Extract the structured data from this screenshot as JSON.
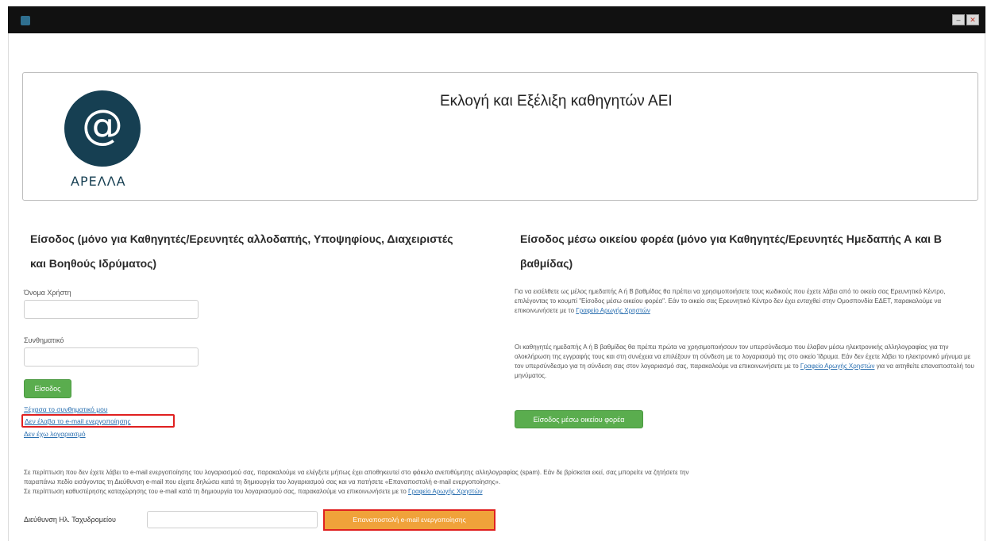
{
  "window": {
    "minimize_label": "–",
    "close_label": "✕"
  },
  "header": {
    "logo_text": "ΑΡΕΛΛΑ",
    "logo_glyph": "@",
    "title": "Εκλογή και Εξέλιξη καθηγητών ΑΕΙ"
  },
  "left": {
    "title": "Είσοδος (μόνο για Καθηγητές/Ερευνητές αλλοδαπής, Υποψηφίους, Διαχειριστές και Βοηθούς Ιδρύματος)",
    "username_label": "Όνομα Χρήστη",
    "password_label": "Συνθηματικό",
    "login_button": "Είσοδος",
    "forgot_password_link": "Ξέχασα το συνθηματικό μου",
    "no_email_link": "Δεν έλαβα το e-mail ενεργοποίησης",
    "register_link": "Δεν έχω λογαριασμό"
  },
  "right": {
    "title": "Είσοδος μέσω οικείου φορέα (μόνο για Καθηγητές/Ερευνητές Ημεδαπής Α και Β βαθμίδας)",
    "para1": "Για να εισέλθετε ως μέλος ημεδαπής Α ή Β βαθμίδας θα πρέπει να χρησιμοποιήσετε τους κωδικούς που έχετε λάβει από το οικείο σας Ερευνητικό Κέντρο, επιλέγοντας το κουμπί \"Είσοδος μέσω οικείου φορέα\". Εάν το οικείο σας Ερευνητικό Κέντρο δεν έχει ενταχθεί στην Ομοσπονδία ΕΔΕΤ, παρακαλούμε να επικοινωνήσετε με το",
    "para1_link": "Γραφείο Αρωγής Χρηστών",
    "para2": "Οι καθηγητές ημεδαπής Α ή Β βαθμίδας θα πρέπει πρώτα να χρησιμοποιήσουν τον υπερσύνδεσμο που έλαβαν μέσω ηλεκτρονικής αλληλογραφίας για την ολοκλήρωση της εγγραφής τους και στη συνέχεια να επιλέξουν τη σύνδεση με το λογαριασμό της στο οικείο Ίδρυμα. Εάν δεν έχετε λάβει το ηλεκτρονικό μήνυμα με τον υπερσύνδεσμο για τη σύνδεση σας στον λογαριασμό σας, παρακαλούμε να επικοινωνήσετε με το",
    "para2_link": "Γραφείο Αρωγής Χρηστών",
    "para2_end": "για να αιτηθείτε επαναποστολή του μηνύματος.",
    "login_button": "Είσοδος μέσω οικείου φορέα"
  },
  "bottom": {
    "line1": "Σε περίπτωση που δεν έχετε λάβει το e-mail ενεργοποίησης του λογαριασμού σας, παρακαλούμε να ελέγξετε μήπως έχει αποθηκευτεί στο φάκελο ανεπιθύμητης αλληλογραφίας (spam). Εάν δε βρίσκεται εκεί, σας μπορείτε να ζητήσετε την",
    "line2": "παραπάνω πεδίο εισάγοντας τη Διεύθυνση e-mail που είχατε δηλώσει κατά τη δημιουργία του λογαριασμού σας και να πατήσετε «Επαναποστολή e-mail ενεργοποίησης».",
    "line3": "Σε περίπτωση καθυστέρησης καταχώρησης του e-mail κατά τη δημιουργία του λογαριασμού σας, παρακαλούμε να επικοινωνήσετε με το",
    "line3_link": "Γραφείο Αρωγής Χρηστών",
    "email_label": "Διεύθυνση Ηλ. Ταχυδρομείου",
    "resend_button": "Επαναποστολή e-mail ενεργοποίησης"
  },
  "colors": {
    "header_bar": "#111111",
    "logo": "#163f52",
    "green_button": "#5aad4e",
    "orange_button": "#f0a23a",
    "highlight": "#e02020",
    "link": "#2a6fb0"
  }
}
